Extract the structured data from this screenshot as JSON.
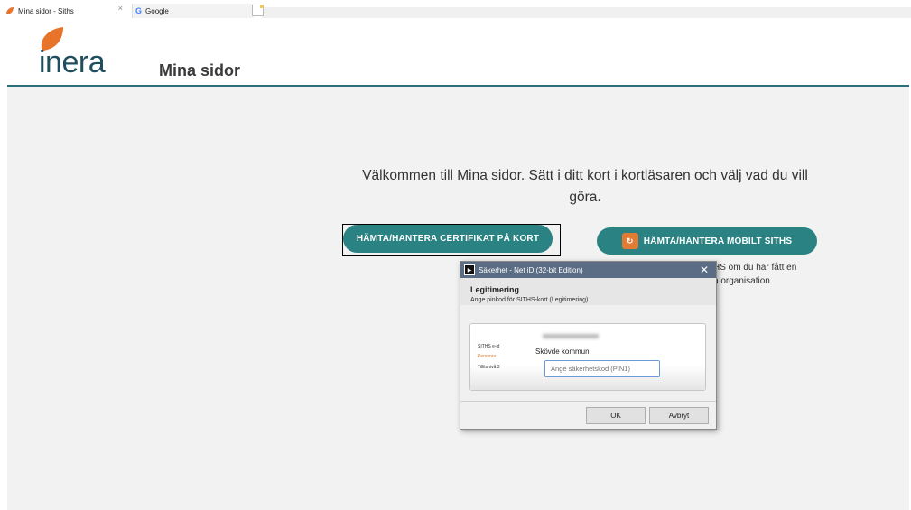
{
  "tabs": [
    {
      "label": "Mina sidor - Siths",
      "close": "×"
    },
    {
      "label": "Google"
    }
  ],
  "header": {
    "logo_text": "inera",
    "page_title": "Mina sidor"
  },
  "main": {
    "welcome_line1": "Välkommen till Mina sidor. Sätt i ditt kort i kortläsaren och välj vad du vill",
    "welcome_line2": "göra.",
    "btn_card": "HÄMTA/HANTERA CERTIFIKAT PÅ KORT",
    "btn_mobile": "HÄMTA/HANTERA MOBILT SITHS",
    "side_line1": "HS om du har fått en",
    "side_line2": "n organisation"
  },
  "dialog": {
    "title": "Säkerhet - Net iD (32-bit Edition)",
    "close": "✕",
    "heading": "Legitimering",
    "subtitle": "Ange pinkod för SITHS-kort (Legitimering)",
    "card_labels": [
      "SITHS e-id",
      "Personnr",
      "Tillitsnivå 3"
    ],
    "organization": "Skövde kommun",
    "pin_placeholder": "Ange säkerhetskod (PIN1)",
    "ok": "OK",
    "cancel": "Avbryt"
  },
  "colors": {
    "accent": "#2a8283",
    "rule": "#2b6f7d",
    "logo_orange": "#e8742a",
    "dialog_titlebar": "#5a6d84"
  }
}
